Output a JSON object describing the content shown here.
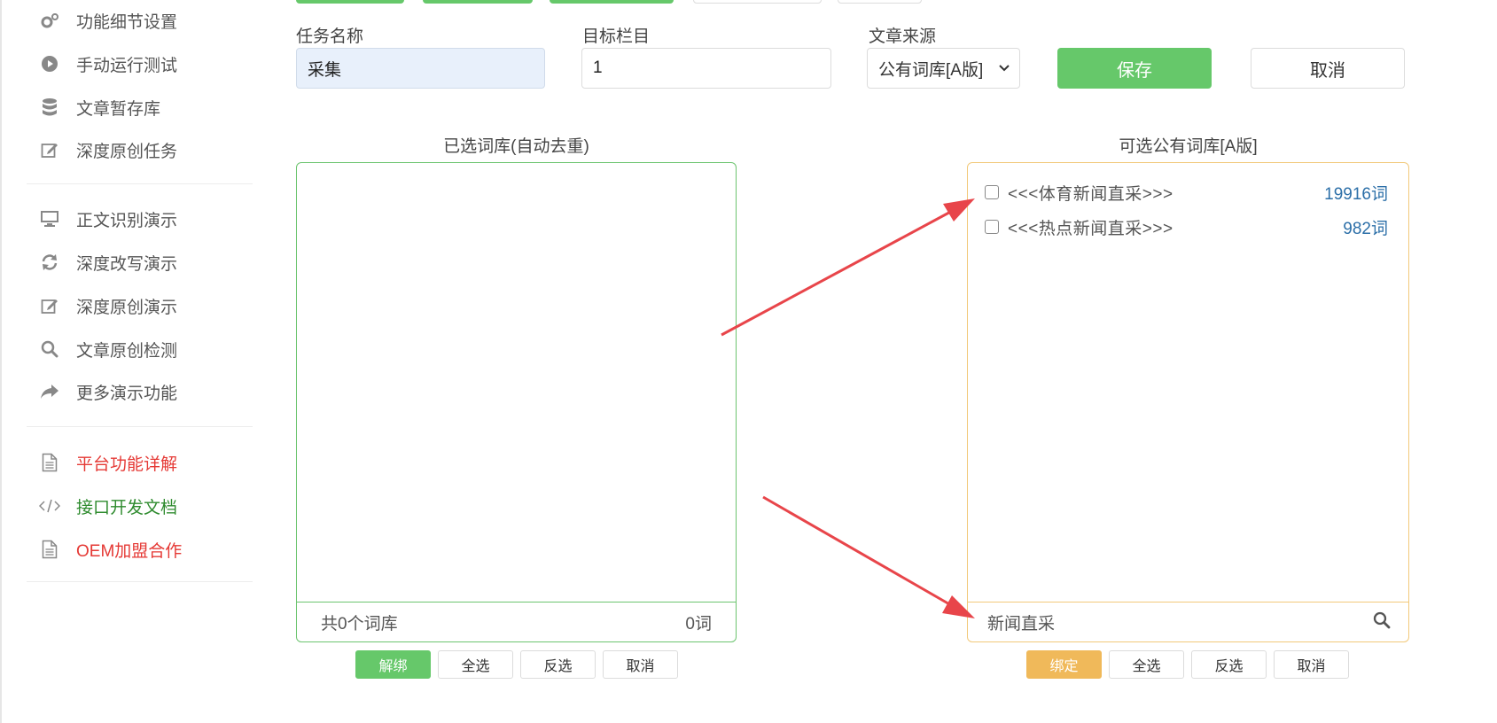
{
  "sidebar": {
    "items": [
      {
        "label": "功能细节设置",
        "icon": "gears-icon"
      },
      {
        "label": "手动运行测试",
        "icon": "play-circle-icon"
      },
      {
        "label": "文章暂存库",
        "icon": "database-icon"
      },
      {
        "label": "深度原创任务",
        "icon": "edit-icon"
      },
      {
        "label": "正文识别演示",
        "icon": "monitor-icon"
      },
      {
        "label": "深度改写演示",
        "icon": "refresh-icon"
      },
      {
        "label": "深度原创演示",
        "icon": "edit-icon"
      },
      {
        "label": "文章原创检测",
        "icon": "search-icon"
      },
      {
        "label": "更多演示功能",
        "icon": "share-icon"
      },
      {
        "label": "平台功能详解",
        "icon": "document-icon",
        "color": "#e53935"
      },
      {
        "label": "接口开发文档",
        "icon": "code-icon",
        "color": "#2e8b2e"
      },
      {
        "label": "OEM加盟合作",
        "icon": "document-icon",
        "color": "#e53935"
      }
    ]
  },
  "form": {
    "task_label": "任务名称",
    "task_value": "采集",
    "column_label": "目标栏目",
    "column_value": "1",
    "source_label": "文章来源",
    "source_value": "公有词库[A版]",
    "save_label": "保存",
    "cancel_label": "取消"
  },
  "left_panel": {
    "title": "已选词库(自动去重)",
    "total": "共0个词库",
    "words": "0词",
    "buttons": {
      "unbind": "解绑",
      "select_all": "全选",
      "invert": "反选",
      "cancel": "取消"
    }
  },
  "right_panel": {
    "title": "可选公有词库[A版]",
    "items": [
      {
        "name": "<<<体育新闻直采>>>",
        "count": "19916词"
      },
      {
        "name": "<<<热点新闻直采>>>",
        "count": "982词"
      }
    ],
    "search_value": "新闻直采",
    "buttons": {
      "bind": "绑定",
      "select_all": "全选",
      "invert": "反选",
      "cancel": "取消"
    }
  },
  "colors": {
    "green": "#66c86a",
    "orange": "#f0b95a",
    "arrow": "#e8454a"
  }
}
